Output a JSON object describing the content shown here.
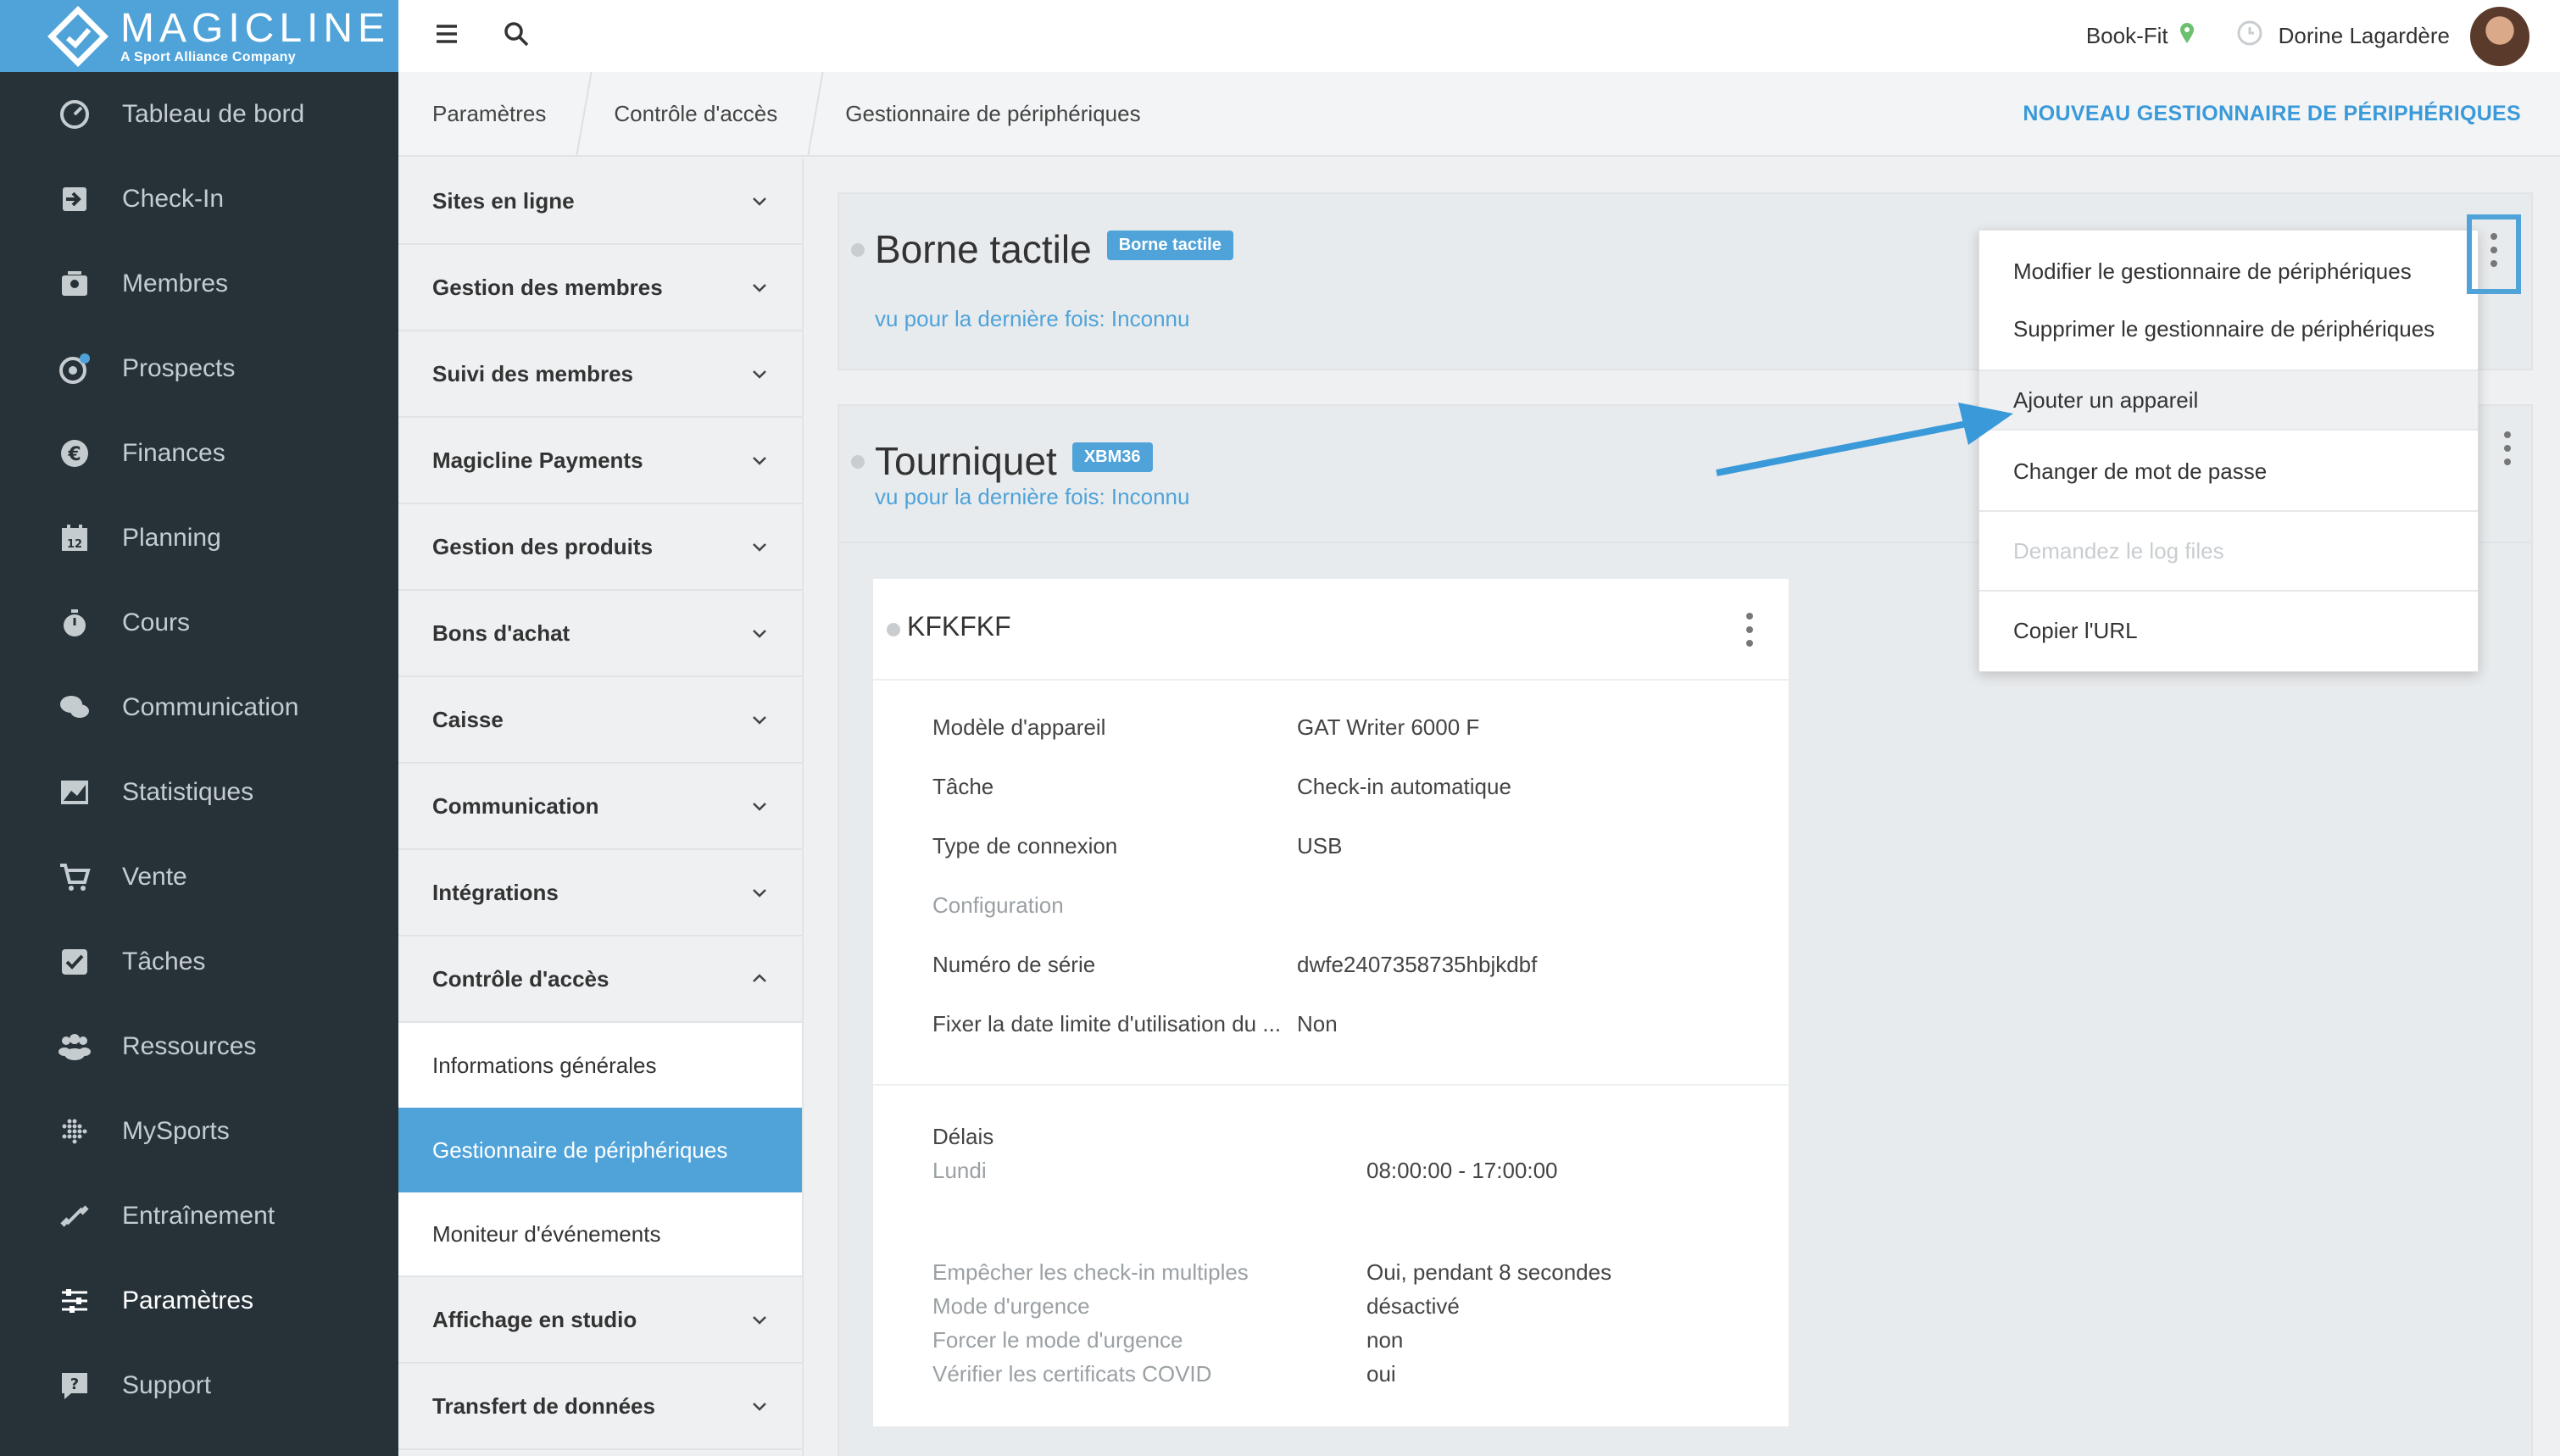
{
  "brand": {
    "name": "MAGICLINE",
    "tagline": "A Sport Alliance Company"
  },
  "sidebar": {
    "items": [
      {
        "label": "Tableau de bord",
        "icon": "dashboard-icon"
      },
      {
        "label": "Check-In",
        "icon": "check-in-icon"
      },
      {
        "label": "Membres",
        "icon": "members-icon"
      },
      {
        "label": "Prospects",
        "icon": "prospects-icon"
      },
      {
        "label": "Finances",
        "icon": "euro-icon"
      },
      {
        "label": "Planning",
        "icon": "calendar-icon"
      },
      {
        "label": "Cours",
        "icon": "timer-icon"
      },
      {
        "label": "Communication",
        "icon": "chat-icon"
      },
      {
        "label": "Statistiques",
        "icon": "chart-icon"
      },
      {
        "label": "Vente",
        "icon": "cart-icon"
      },
      {
        "label": "Tâches",
        "icon": "checkbox-icon"
      },
      {
        "label": "Ressources",
        "icon": "group-icon"
      },
      {
        "label": "MySports",
        "icon": "dots-grid-icon"
      },
      {
        "label": "Entraînement",
        "icon": "dumbbell-icon"
      },
      {
        "label": "Paramètres",
        "icon": "sliders-icon"
      },
      {
        "label": "Support",
        "icon": "help-icon"
      }
    ]
  },
  "topbar": {
    "studio": "Book-Fit",
    "user": "Dorine Lagardère"
  },
  "breadcrumb": {
    "items": [
      "Paramètres",
      "Contrôle d'accès",
      "Gestionnaire de périphériques"
    ],
    "action": "NOUVEAU GESTIONNAIRE DE PÉRIPHÉRIQUES"
  },
  "settings": {
    "groups": [
      "Sites en ligne",
      "Gestion des membres",
      "Suivi des membres",
      "Magicline Payments",
      "Gestion des produits",
      "Bons d'achat",
      "Caisse",
      "Communication",
      "Intégrations",
      "Contrôle d'accès"
    ],
    "sub": [
      "Informations générales",
      "Gestionnaire de périphériques",
      "Moniteur d'événements"
    ],
    "after": [
      "Affichage en studio",
      "Transfert de données"
    ]
  },
  "panels": {
    "borne": {
      "title": "Borne tactile",
      "badge": "Borne tactile",
      "last_seen": "vu pour la dernière fois: Inconnu"
    },
    "tourniquet": {
      "title": "Tourniquet",
      "badge": "XBM36",
      "last_seen": "vu pour la dernière fois: Inconnu"
    }
  },
  "device": {
    "title": "KFKFKF",
    "props": [
      {
        "k": "Modèle d'appareil",
        "v": "GAT Writer 6000 F"
      },
      {
        "k": "Tâche",
        "v": "Check-in automatique"
      },
      {
        "k": "Type de connexion",
        "v": "USB"
      },
      {
        "k": "Configuration",
        "v": ""
      },
      {
        "k": "Numéro de série",
        "v": "dwfe2407358735hbjkdbf"
      },
      {
        "k": "Fixer la date limite d'utilisation du ...",
        "v": "Non"
      }
    ],
    "delais_title": "Délais",
    "delais": [
      {
        "k": "Lundi",
        "v": "08:00:00 - 17:00:00"
      }
    ],
    "options": [
      {
        "k": "Empêcher les check-in multiples",
        "v": "Oui, pendant 8 secondes"
      },
      {
        "k": "Mode d'urgence",
        "v": "désactivé"
      },
      {
        "k": "Forcer le mode d'urgence",
        "v": "non"
      },
      {
        "k": "Vérifier les certificats COVID",
        "v": "oui"
      }
    ]
  },
  "dropdown": {
    "items": [
      "Modifier le gestionnaire de périphériques",
      "Supprimer le gestionnaire de périphériques",
      "Ajouter un appareil",
      "Changer de mot de passe",
      "Demandez le log files",
      "Copier l'URL"
    ]
  },
  "colors": {
    "accent": "#4fa3d9",
    "sidebar": "#263238",
    "arrow": "#3a9ad9"
  }
}
